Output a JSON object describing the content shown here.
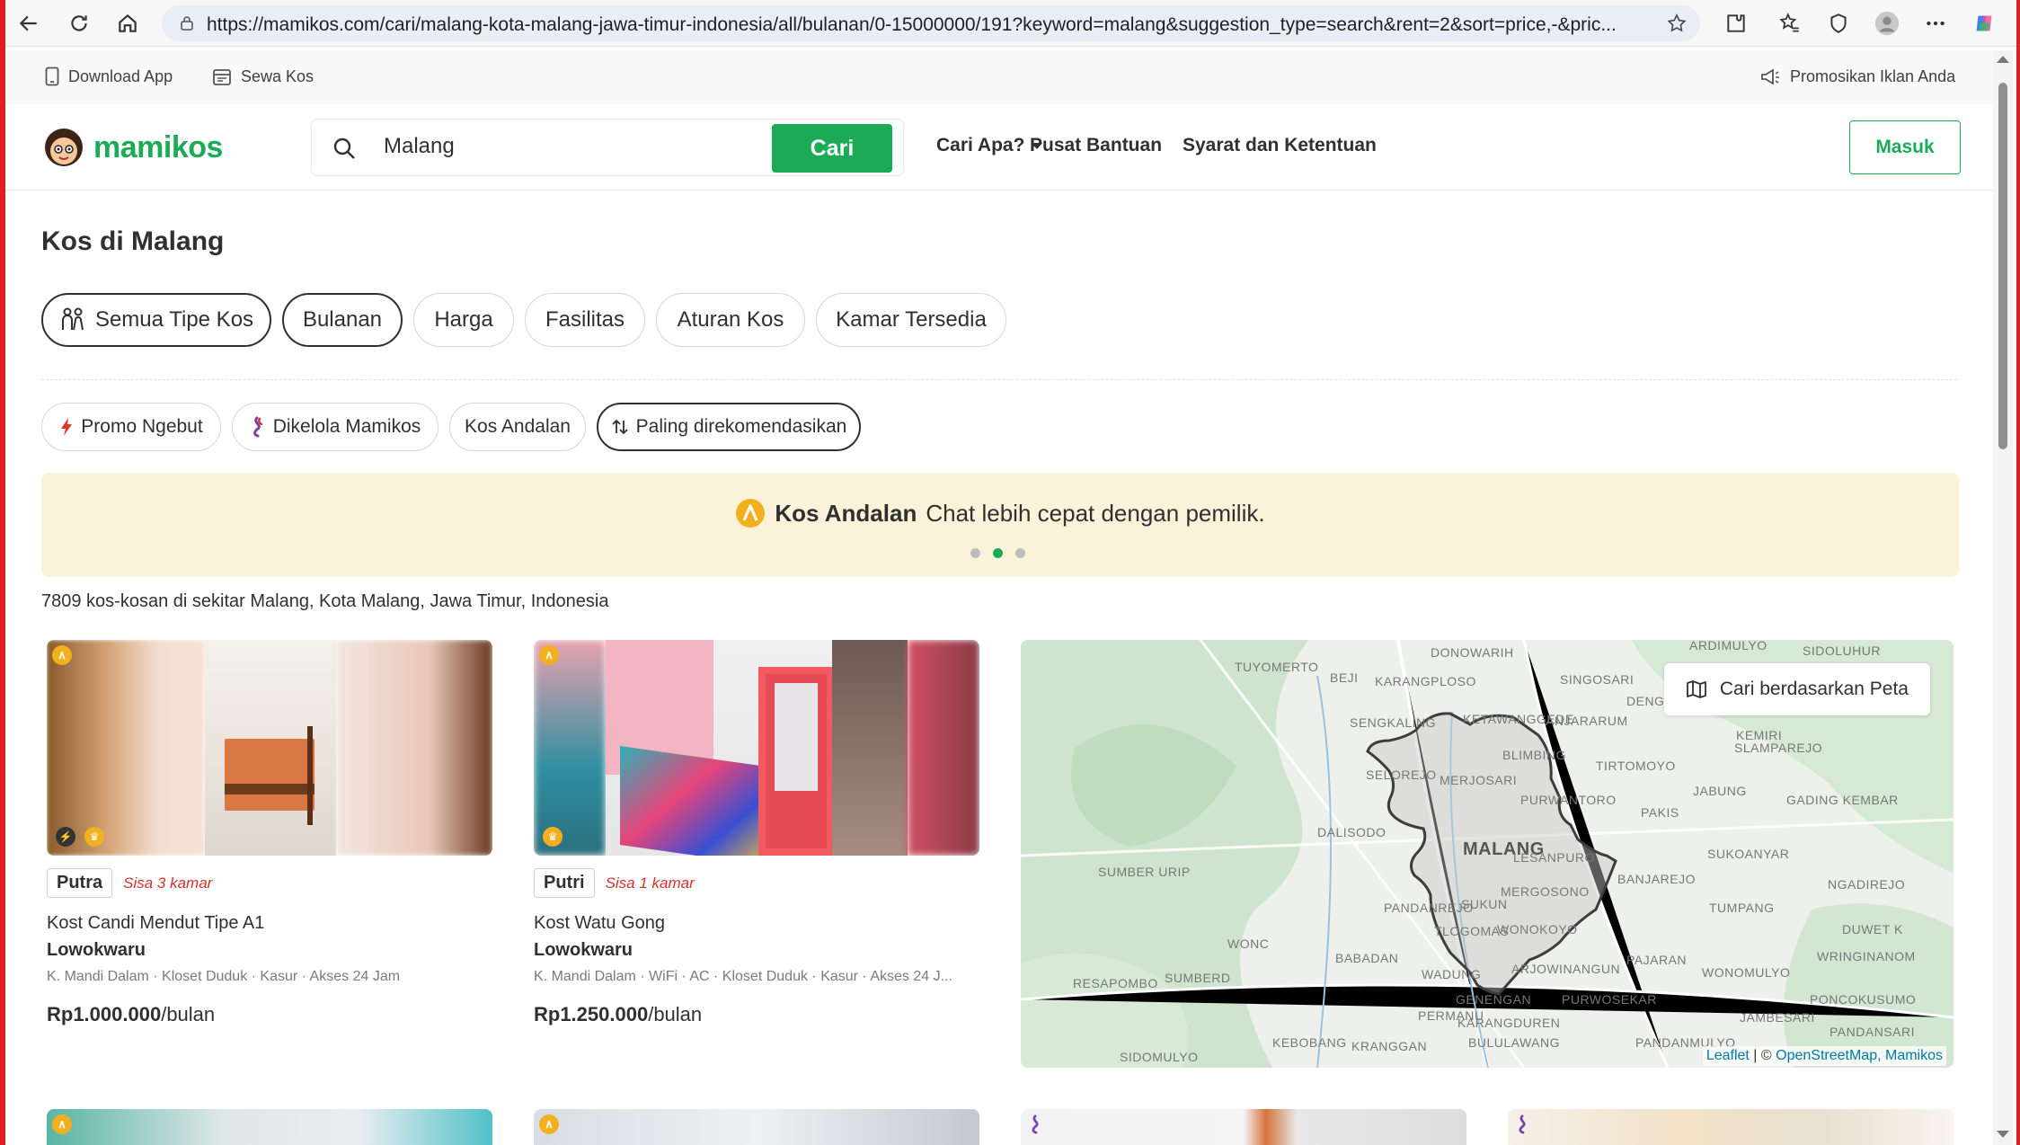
{
  "browser": {
    "url": "https://mamikos.com/cari/malang-kota-malang-jawa-timur-indonesia/all/bulanan/0-15000000/191?keyword=malang&suggestion_type=search&rent=2&sort=price,-&pric..."
  },
  "utility_bar": {
    "download_app": "Download App",
    "sewa_kos": "Sewa Kos",
    "promote": "Promosikan Iklan Anda"
  },
  "header": {
    "logo_text": "mamikos",
    "search_value": "Malang",
    "search_button": "Cari",
    "nav": [
      "Cari Apa?",
      "Pusat Bantuan",
      "Syarat dan Ketentuan"
    ],
    "login": "Masuk"
  },
  "page": {
    "title": "Kos di Malang",
    "filters": [
      "Semua Tipe Kos",
      "Bulanan",
      "Harga",
      "Fasilitas",
      "Aturan Kos",
      "Kamar Tersedia"
    ],
    "chips": [
      "Promo Ngebut",
      "Dikelola Mamikos",
      "Kos Andalan",
      "Paling direkomendasikan"
    ],
    "banner": {
      "bold": "Kos Andalan",
      "text": "Chat lebih cepat dengan pemilik."
    },
    "result_count": "7809 kos-kosan di sekitar Malang, Kota Malang, Jawa Timur, Indonesia"
  },
  "listings": [
    {
      "gender": "Putra",
      "rooms_left": "Sisa 3 kamar",
      "name": "Kost Candi Mendut Tipe A1",
      "area": "Lowokwaru",
      "facilities": "K. Mandi Dalam · Kloset Duduk · Kasur · Akses 24 Jam",
      "price": "Rp1.000.000",
      "period": "/bulan"
    },
    {
      "gender": "Putri",
      "rooms_left": "Sisa 1 kamar",
      "name": "Kost Watu Gong",
      "area": "Lowokwaru",
      "facilities": "K. Mandi Dalam · WiFi · AC · Kloset Duduk · Kasur · Akses 24 J...",
      "price": "Rp1.250.000",
      "period": "/bulan"
    }
  ],
  "map": {
    "button": "Cari berdasarkan Peta",
    "attribution_leaflet": "Leaflet",
    "attribution_sep": " | © ",
    "attribution_osm": "OpenStreetMap, Mamikos",
    "center_label": "MALANG",
    "labels": [
      "DONOWARIH",
      "ARDIMULYO",
      "SIDOLUHUR",
      "TUYOMERTO",
      "BEJI",
      "KARANGPLOSO",
      "SINGOSARI",
      "DENGKOL",
      "SENGKALING",
      "KETAWANGGEDE",
      "ANJARARUM",
      "KEMIRI",
      "SLAMPAREJO",
      "SELOREJO",
      "BLIMBING",
      "TIRTOMOYO",
      "MERJOSARI",
      "PURWANTORO",
      "JABUNG",
      "GADING KEMBAR",
      "DALISODO",
      "PAKIS",
      "SUMBER URIP",
      "LESANPURO",
      "SUKOANYAR",
      "BANJAREJO",
      "NGADIREJO",
      "MERGOSONO",
      "PANDANREJO",
      "TUMPANG",
      "TLOGOMAS",
      "WONOKOYO",
      "DUWET K",
      "BABADAN",
      "ARJOWINANGUN",
      "PAJARAN",
      "WRINGINANOM",
      "RESAPOMBO",
      "SUMBERD",
      "WADUNG",
      "WONOMULYO",
      "GENENGAN",
      "PURWOSEKAR",
      "PONCOKUSUMO",
      "PERMANU",
      "KARANGDUREN",
      "JAMBESARI",
      "KEBOBANG",
      "KRANGGAN",
      "BULULAWANG",
      "PANDANMULYO",
      "PANDANSARI",
      "SIDOMULYO",
      "WONC",
      "SUKUN"
    ]
  }
}
